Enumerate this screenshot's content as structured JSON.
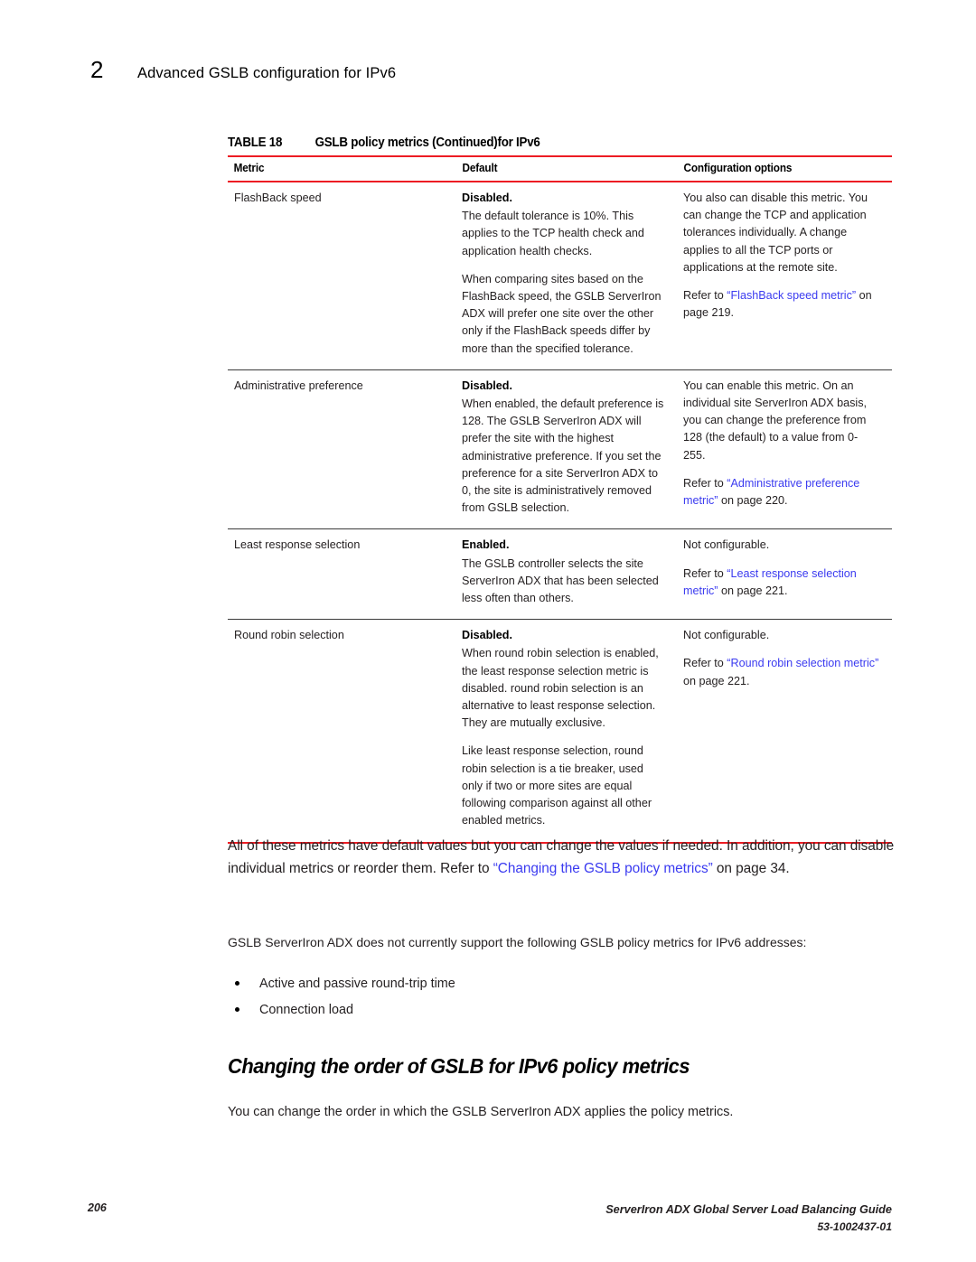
{
  "running_header": {
    "chapter_number": "2",
    "chapter_title": "Advanced GSLB configuration for IPv6"
  },
  "table": {
    "caption_label": "TABLE 18",
    "caption_text": "GSLB policy metrics (Continued)for IPv6",
    "columns": [
      "Metric",
      "Default",
      "Configuration options"
    ],
    "rows": [
      {
        "metric": "FlashBack speed",
        "default_strong": "Disabled.",
        "default_paras": [
          "The default tolerance is 10%. This applies to the TCP health check and application health checks.",
          "When comparing sites based on the FlashBack speed, the GSLB ServerIron ADX will prefer one site over the other only if the FlashBack speeds differ by more than the specified tolerance."
        ],
        "options_para": "You also can disable this metric. You can change the TCP and application tolerances individually. A change applies to all the TCP ports or applications at the remote site.",
        "options_refer_prefix": "Refer to ",
        "options_link": "“FlashBack speed metric”",
        "options_refer_suffix": " on page 219."
      },
      {
        "metric": "Administrative preference",
        "default_strong": "Disabled.",
        "default_paras": [
          "When enabled, the default preference is 128. The GSLB ServerIron ADX will prefer the site with the highest administrative preference. If you set the preference for a site ServerIron ADX to 0, the site is administratively removed from GSLB selection."
        ],
        "options_para": "You can enable this metric. On an individual site ServerIron ADX basis, you can change the preference from 128 (the default) to a value from 0-255.",
        "options_refer_prefix": "Refer to ",
        "options_link": "“Administrative preference metric”",
        "options_refer_suffix": " on page 220."
      },
      {
        "metric": "Least response selection",
        "default_strong": "Enabled.",
        "default_paras": [
          "The GSLB controller selects the site ServerIron ADX that has been selected less often than others."
        ],
        "options_para": "Not configurable.",
        "options_refer_prefix": "Refer to ",
        "options_link": "“Least response selection metric”",
        "options_refer_suffix": " on page 221."
      },
      {
        "metric": "Round robin selection",
        "default_strong": "Disabled.",
        "default_paras": [
          "When round robin selection is enabled, the least response selection metric is disabled. round robin selection is an alternative to least response selection. They are mutually exclusive.",
          "Like least response selection, round robin selection is a tie breaker, used only if two or more sites are equal following comparison against all other enabled metrics."
        ],
        "options_para": "Not configurable.",
        "options_refer_prefix": "Refer to ",
        "options_link": "“Round robin selection metric”",
        "options_refer_suffix": " on page 221."
      }
    ]
  },
  "body": {
    "lead_part1": "All of these metrics have default values but you can change the values if needed. In addition, you can disable individual metrics or reorder them. Refer to ",
    "lead_link": "“Changing the GSLB policy metrics”",
    "lead_part2": " on page 34.",
    "sub_paragraph": "GSLB ServerIron ADX does not currently support the following GSLB policy metrics for IPv6 addresses:",
    "bullets": [
      "Active and passive round-trip time",
      "Connection load"
    ],
    "section_heading": "Changing the order of GSLB for IPv6 policy metrics",
    "after_heading": "You can change the order in which the GSLB ServerIron ADX applies the policy metrics."
  },
  "footer": {
    "page_number": "206",
    "guide_title": "ServerIron ADX Global Server Load Balancing Guide",
    "doc_id": "53-1002437-01"
  },
  "colors": {
    "rule_red": "#ED1C24",
    "xref_blue": "#3b3bf0",
    "body_text": "#231f20"
  }
}
